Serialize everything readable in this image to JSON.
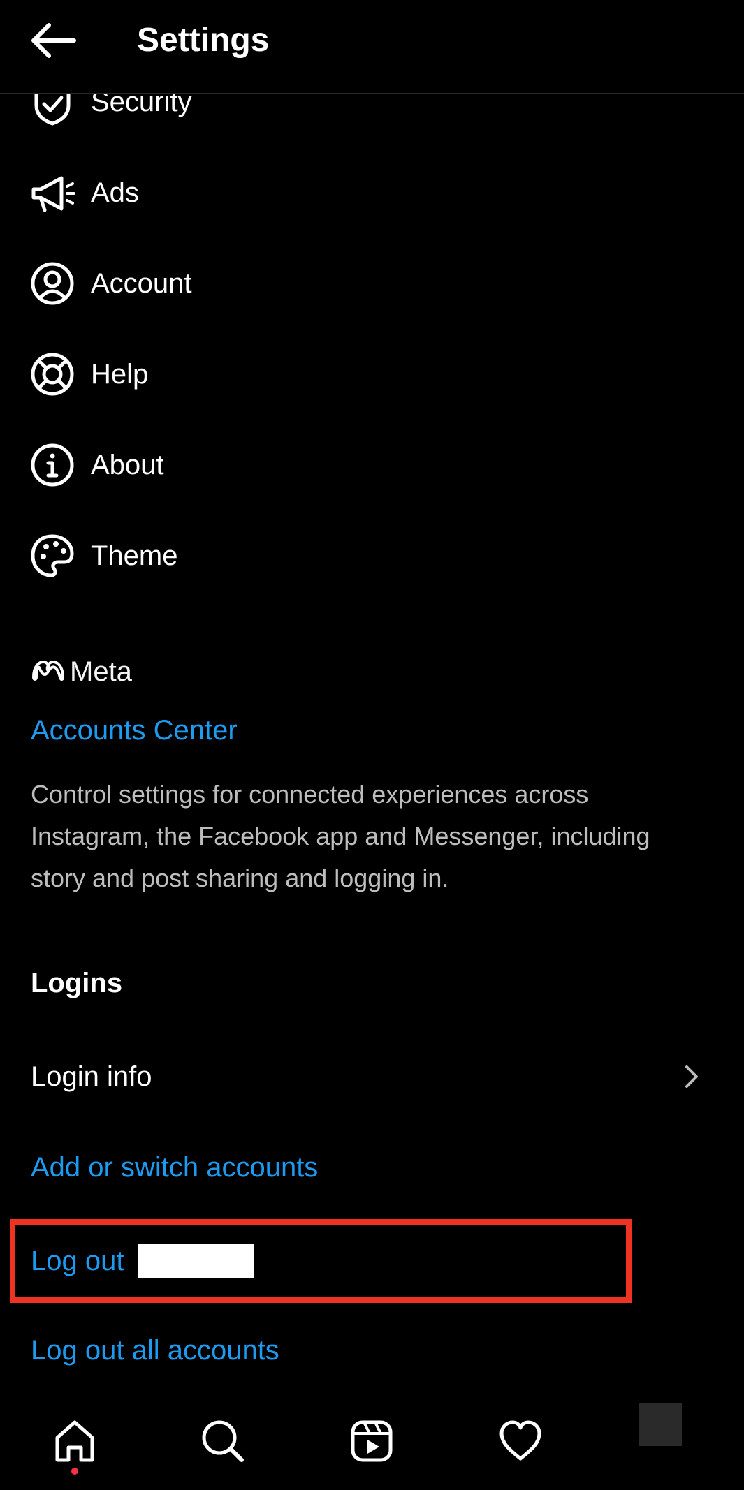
{
  "header": {
    "title": "Settings"
  },
  "menu": [
    {
      "key": "security",
      "label": "Security",
      "icon": "shield-check-icon"
    },
    {
      "key": "ads",
      "label": "Ads",
      "icon": "megaphone-icon"
    },
    {
      "key": "account",
      "label": "Account",
      "icon": "user-circle-icon"
    },
    {
      "key": "help",
      "label": "Help",
      "icon": "lifebuoy-icon"
    },
    {
      "key": "about",
      "label": "About",
      "icon": "info-icon"
    },
    {
      "key": "theme",
      "label": "Theme",
      "icon": "palette-icon"
    }
  ],
  "meta": {
    "logo_text": "Meta",
    "accounts_center_label": "Accounts Center",
    "description": "Control settings for connected experiences across Instagram, the Facebook app and Messenger, including story and post sharing and logging in."
  },
  "logins": {
    "heading": "Logins",
    "login_info_label": "Login info",
    "add_switch_label": "Add or switch accounts",
    "log_out_label": "Log out",
    "log_out_all_label": "Log out all accounts"
  },
  "bottom_nav": [
    "home-icon",
    "search-icon",
    "reels-icon",
    "heart-icon"
  ],
  "colors": {
    "link": "#1d9bf0",
    "highlight": "#ee3322",
    "background": "#000000"
  }
}
